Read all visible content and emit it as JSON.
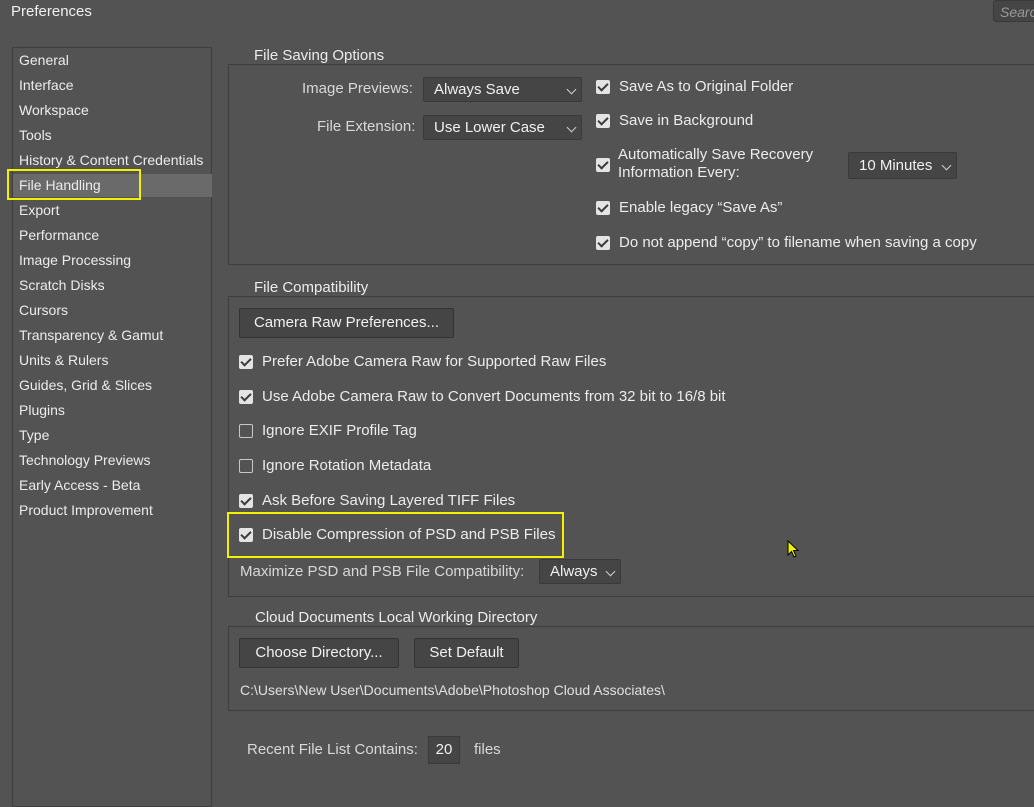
{
  "window": {
    "title": "Preferences",
    "search_placeholder": "Search"
  },
  "sidebar": {
    "items": [
      {
        "label": "General"
      },
      {
        "label": "Interface"
      },
      {
        "label": "Workspace"
      },
      {
        "label": "Tools"
      },
      {
        "label": "History & Content Credentials"
      },
      {
        "label": "File Handling"
      },
      {
        "label": "Export"
      },
      {
        "label": "Performance"
      },
      {
        "label": "Image Processing"
      },
      {
        "label": "Scratch Disks"
      },
      {
        "label": "Cursors"
      },
      {
        "label": "Transparency & Gamut"
      },
      {
        "label": "Units & Rulers"
      },
      {
        "label": "Guides, Grid & Slices"
      },
      {
        "label": "Plugins"
      },
      {
        "label": "Type"
      },
      {
        "label": "Technology Previews"
      },
      {
        "label": "Early Access - Beta"
      },
      {
        "label": "Product Improvement"
      }
    ],
    "selected": "File Handling"
  },
  "file_saving": {
    "legend": "File Saving Options",
    "image_previews_label": "Image Previews:",
    "image_previews_value": "Always Save",
    "file_extension_label": "File Extension:",
    "file_extension_value": "Use Lower Case",
    "save_as_original": {
      "label": "Save As to Original Folder",
      "checked": true
    },
    "save_background": {
      "label": "Save in Background",
      "checked": true
    },
    "auto_recovery": {
      "label_line1": "Automatically Save Recovery",
      "label_line2": "Information Every:",
      "checked": true,
      "interval": "10 Minutes"
    },
    "legacy_save_as": {
      "label": "Enable legacy “Save As”",
      "checked": true
    },
    "no_copy_append": {
      "label": "Do not append “copy” to filename when saving a copy",
      "checked": true
    }
  },
  "file_compat": {
    "legend": "File Compatibility",
    "camera_raw_button": "Camera Raw Preferences...",
    "prefer_acr": {
      "label": "Prefer Adobe Camera Raw for Supported Raw Files",
      "checked": true
    },
    "use_acr_convert": {
      "label": "Use Adobe Camera Raw to Convert Documents from 32 bit to 16/8 bit",
      "checked": true
    },
    "ignore_exif": {
      "label": "Ignore EXIF Profile Tag",
      "checked": false
    },
    "ignore_rotation": {
      "label": "Ignore Rotation Metadata",
      "checked": false
    },
    "ask_tiff": {
      "label": "Ask Before Saving Layered TIFF Files",
      "checked": true
    },
    "disable_compression": {
      "label": "Disable Compression of PSD and PSB Files",
      "checked": true
    },
    "maximize_label": "Maximize PSD and PSB File Compatibility:",
    "maximize_value": "Always"
  },
  "cloud_docs": {
    "legend": "Cloud Documents Local Working Directory",
    "choose_button": "Choose Directory...",
    "default_button": "Set Default",
    "path": "C:\\Users\\New User\\Documents\\Adobe\\Photoshop Cloud Associates\\"
  },
  "recent_files": {
    "label": "Recent File List Contains:",
    "value": "20",
    "suffix": "files"
  },
  "colors": {
    "highlight": "#f2f200",
    "panel": "#535353",
    "field": "#454545"
  }
}
